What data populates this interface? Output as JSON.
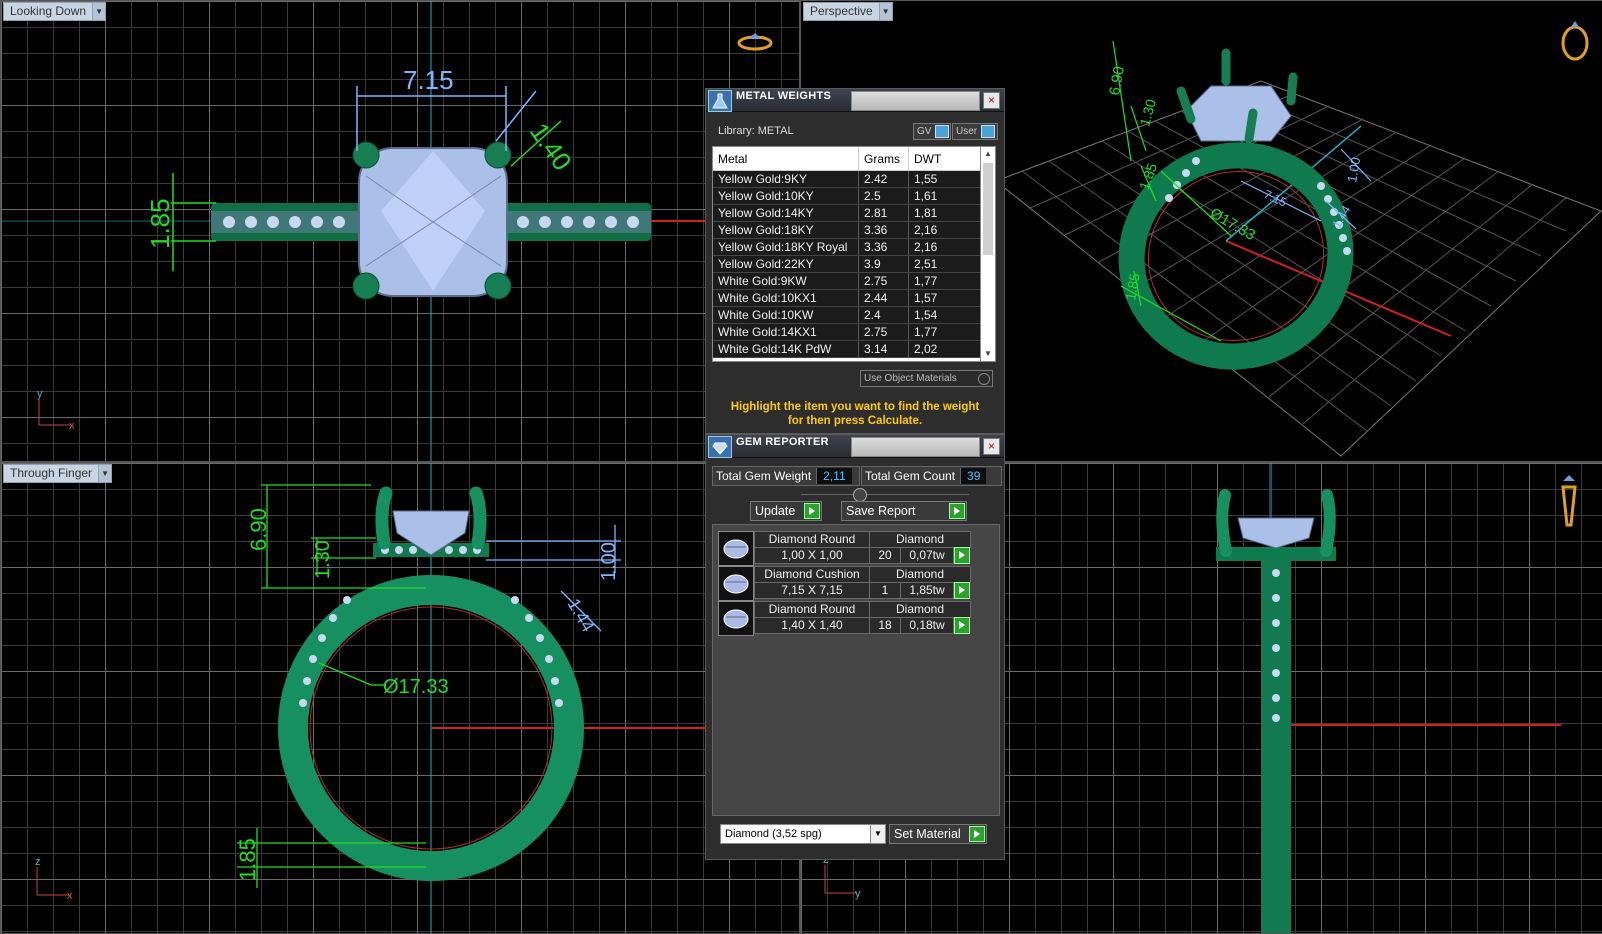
{
  "viewports": {
    "top_left": {
      "label": "Looking Down",
      "axis_v": "y",
      "axis_h": "x",
      "dims": {
        "width": "7.15",
        "prong": "1.40",
        "height": "1.85"
      }
    },
    "top_right": {
      "label": "Perspective",
      "dims": {
        "d1": "6.90",
        "d2": "1.30",
        "d3": "1.85",
        "d4": "1.00",
        "d5": "1.44",
        "d6": "7.15",
        "diam": "Ø17.33"
      }
    },
    "bottom_left": {
      "label": "Through Finger",
      "axis_v": "z",
      "axis_h": "x",
      "dims": {
        "total": "6.90",
        "gallery": "1.30",
        "shank": "1.85",
        "pave": "1.00",
        "side": "1.44",
        "diam": "Ø17.33"
      }
    },
    "bottom_right": {
      "label": "",
      "axis_v": "z",
      "axis_h": "y"
    }
  },
  "metal_weights": {
    "title": "METAL WEIGHTS",
    "library_label": "Library: METAL",
    "btn_gv": "GV",
    "btn_user": "User",
    "columns": [
      "Metal",
      "Grams",
      "DWT"
    ],
    "rows": [
      [
        "Yellow Gold:9KY",
        "2.42",
        "1,55"
      ],
      [
        "Yellow Gold:10KY",
        "2.5",
        "1,61"
      ],
      [
        "Yellow Gold:14KY",
        "2.81",
        "1,81"
      ],
      [
        "Yellow Gold:18KY",
        "3.36",
        "2,16"
      ],
      [
        "Yellow Gold:18KY Royal",
        "3.36",
        "2,16"
      ],
      [
        "Yellow Gold:22KY",
        "3.9",
        "2,51"
      ],
      [
        "White Gold:9KW",
        "2.75",
        "1,77"
      ],
      [
        "White Gold:10KX1",
        "2.44",
        "1,57"
      ],
      [
        "White Gold:10KW",
        "2.4",
        "1,54"
      ],
      [
        "White Gold:14KX1",
        "2.75",
        "1,77"
      ],
      [
        "White Gold:14K PdW",
        "3.14",
        "2,02"
      ]
    ],
    "use_object_materials": "Use Object Materials",
    "hint_line1": "Highlight the item you want to find the weight",
    "hint_line2": "for then press Calculate."
  },
  "gem_reporter": {
    "title": "GEM REPORTER",
    "total_weight_label": "Total Gem Weight",
    "total_weight_value": "2,11",
    "total_count_label": "Total Gem Count",
    "total_count_value": "39",
    "update_label": "Update",
    "save_report_label": "Save Report",
    "gems": [
      {
        "name": "Diamond Round",
        "material": "Diamond",
        "size": "1,00 X 1,00",
        "count": "20",
        "weight": "0,07tw"
      },
      {
        "name": "Diamond Cushion",
        "material": "Diamond",
        "size": "7,15 X 7,15",
        "count": "1",
        "weight": "1,85tw"
      },
      {
        "name": "Diamond Round",
        "material": "Diamond",
        "size": "1,40 X 1,40",
        "count": "18",
        "weight": "0,18tw"
      }
    ],
    "material_select": "Diamond     (3,52 spg)",
    "set_material_label": "Set Material"
  },
  "colors": {
    "metal": "#1a8a5a",
    "dimension": "#22dd22",
    "dimension_blue": "#7fb6ff",
    "hint": "#ffcc00",
    "value": "#48c8ff"
  }
}
